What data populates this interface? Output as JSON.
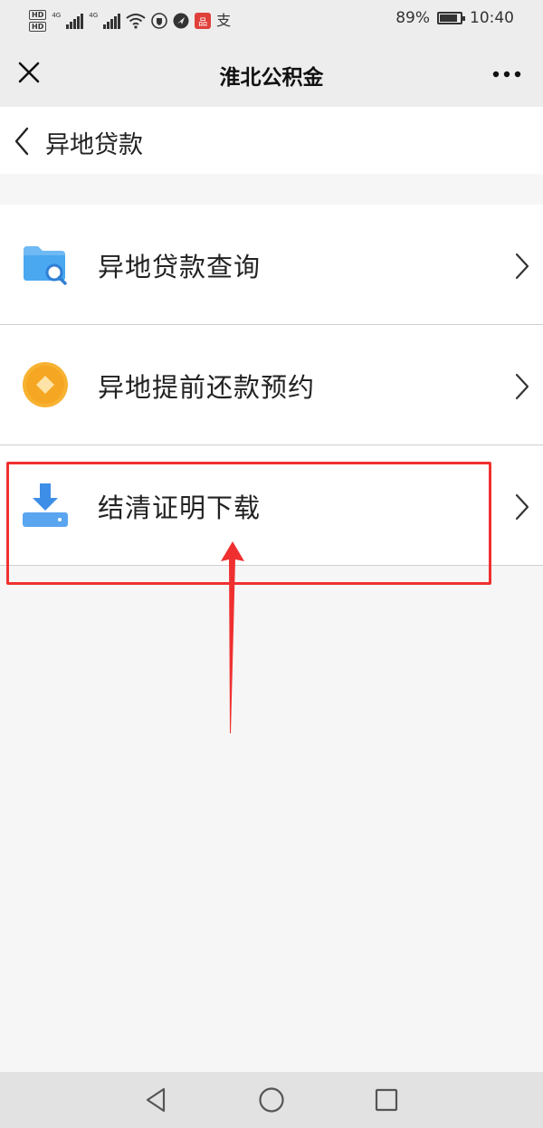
{
  "status_bar": {
    "hd_badges": [
      "HD",
      "HD"
    ],
    "network_labels": [
      "4G",
      "4G"
    ],
    "wifi_icon": "wifi-icon",
    "app_icons": [
      "shield-icon",
      "navigation-icon",
      "red-app-icon",
      "alipay-icon"
    ],
    "red_app_text": "品",
    "alipay_glyph": "支",
    "battery_percent": "89%",
    "battery_level": 0.89,
    "time": "10:40"
  },
  "header": {
    "title": "淮北公积金",
    "close_icon": "close-icon",
    "more_icon": "more-icon"
  },
  "page": {
    "back_icon": "back-icon",
    "title": "异地贷款"
  },
  "menu": {
    "items": [
      {
        "label": "异地贷款查询",
        "icon": "folder-search-icon",
        "icon_color": "#4aa8f0"
      },
      {
        "label": "异地提前还款预约",
        "icon": "coin-diamond-icon",
        "icon_color": "#f7b232"
      },
      {
        "label": "结清证明下载",
        "icon": "download-icon",
        "icon_color": "#3d8ee6"
      }
    ],
    "chevron_icon": "chevron-right-icon"
  },
  "annotation": {
    "highlight_color": "#f03030",
    "highlight_target": "结清证明下载"
  },
  "nav_bar": {
    "buttons": [
      "back-triangle-icon",
      "home-circle-icon",
      "recents-square-icon"
    ]
  },
  "colors": {
    "header_bg": "#ededed",
    "page_bg": "#f6f6f6",
    "list_bg": "#ffffff",
    "divider": "#cfcfcf"
  }
}
